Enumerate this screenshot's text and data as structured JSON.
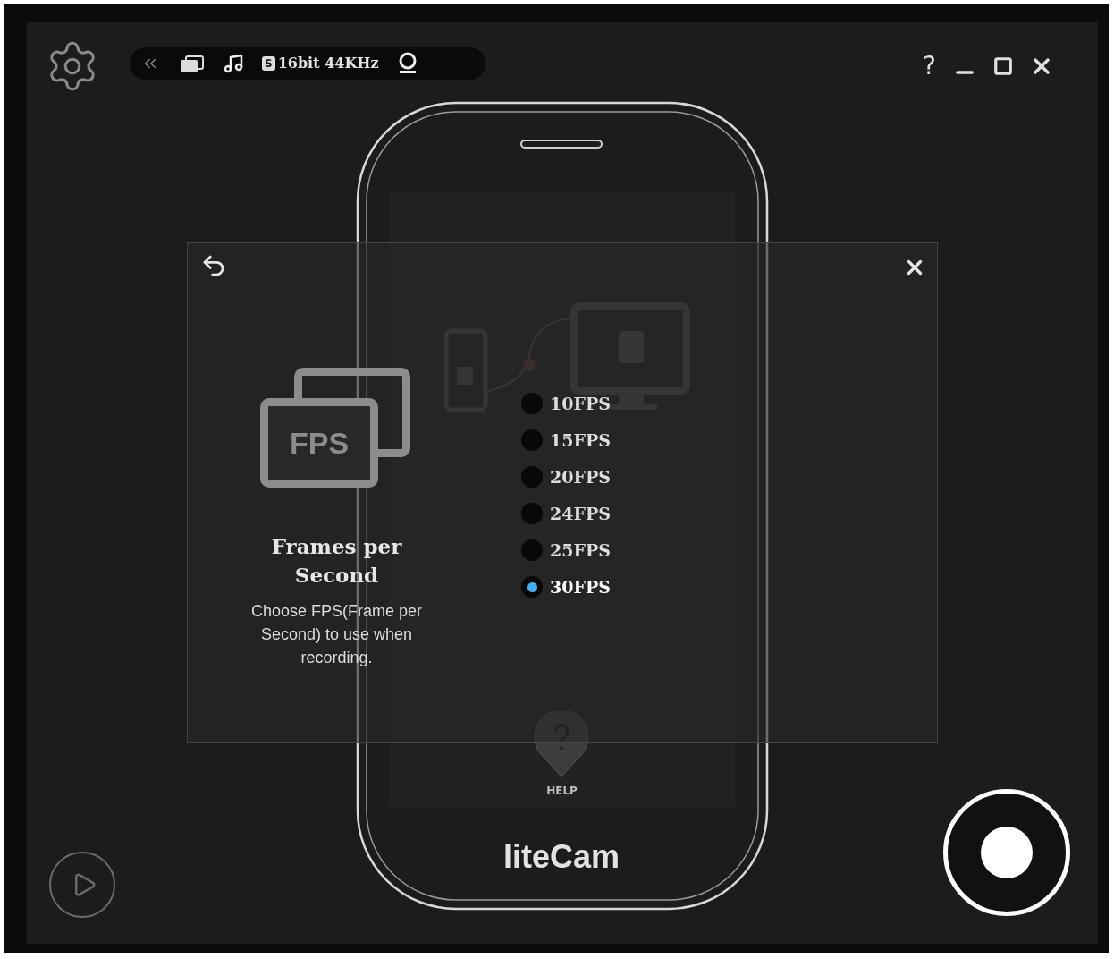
{
  "toolbar": {
    "sample_badge": "S",
    "audio_format": "16bit 44KHz"
  },
  "window_controls": {
    "help": "?"
  },
  "phone_screen": {
    "help_label": "HELP",
    "brand": "liteCam"
  },
  "fps_dialog": {
    "icon_label": "FPS",
    "title": "Frames per Second",
    "description": "Choose FPS(Frame per Second) to use when recording.",
    "options": [
      {
        "label": "10FPS",
        "selected": false
      },
      {
        "label": "15FPS",
        "selected": false
      },
      {
        "label": "20FPS",
        "selected": false
      },
      {
        "label": "24FPS",
        "selected": false
      },
      {
        "label": "25FPS",
        "selected": false
      },
      {
        "label": "30FPS",
        "selected": true
      }
    ]
  }
}
